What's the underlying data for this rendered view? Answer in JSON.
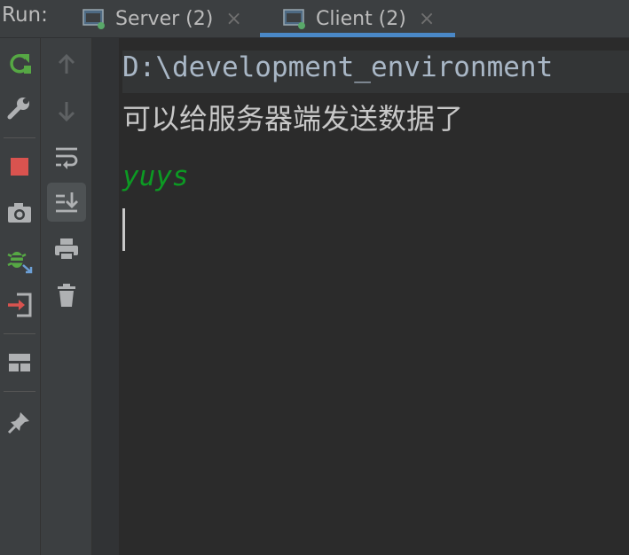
{
  "run_panel": {
    "label": "Run:",
    "tabs": [
      {
        "title": "Server (2)",
        "close": "×",
        "active": false
      },
      {
        "title": "Client (2)",
        "close": "×",
        "active": true
      }
    ]
  },
  "console": {
    "command_line": "D:\\development_environment",
    "lines": [
      {
        "text": "可以给服务器端发送数据了",
        "kind": "program-output"
      },
      {
        "text": "yuys",
        "kind": "user-input"
      }
    ]
  },
  "colors": {
    "rerun": "#56a844",
    "stop": "#d9534f",
    "debug": "#56a844",
    "input_text": "#0c9a23",
    "accent": "#4a88c7"
  },
  "toolbar_left": [
    "rerun-icon",
    "wrench-icon",
    "stop-icon",
    "camera-icon",
    "debug-icon",
    "exit-icon",
    "layout-icon",
    "pin-icon"
  ],
  "toolbar_right": [
    "arrow-up-icon",
    "arrow-down-icon",
    "soft-wrap-icon",
    "scroll-to-end-icon",
    "print-icon",
    "trash-icon"
  ]
}
